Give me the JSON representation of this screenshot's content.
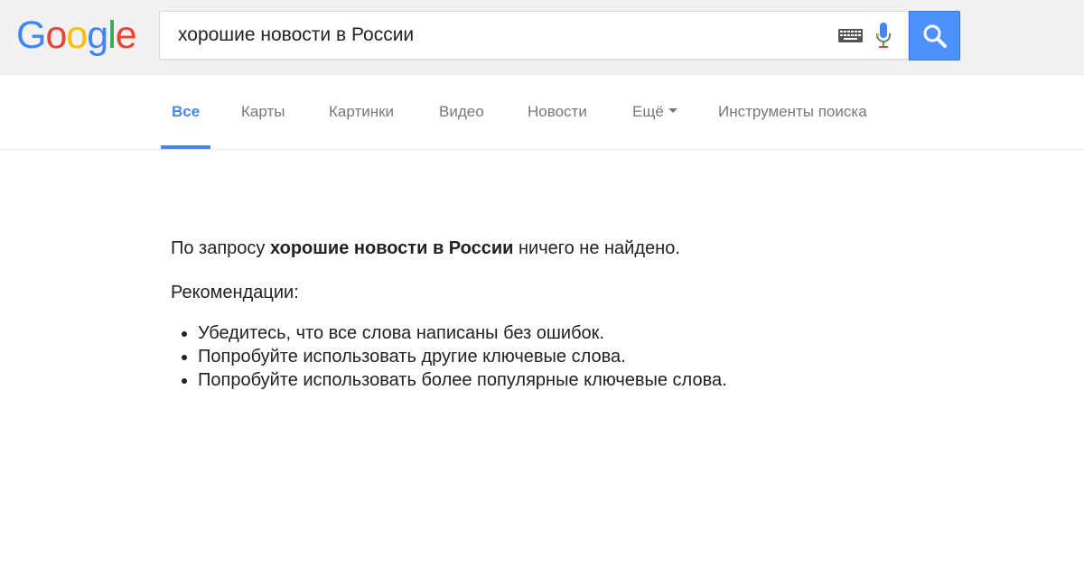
{
  "header": {
    "logo_text": "Google",
    "logo_letters": [
      {
        "ch": "G",
        "color": "#4285f4"
      },
      {
        "ch": "o",
        "color": "#ea4335"
      },
      {
        "ch": "o",
        "color": "#fbbc05"
      },
      {
        "ch": "g",
        "color": "#4285f4"
      },
      {
        "ch": "l",
        "color": "#34a853"
      },
      {
        "ch": "e",
        "color": "#ea4335"
      }
    ],
    "search": {
      "value": "хорошие новости в России",
      "keyboard_icon": "keyboard-icon",
      "mic_icon": "microphone-icon",
      "button_icon": "search-icon"
    },
    "accent_color": "#4d90fe"
  },
  "tabs": [
    {
      "label": "Все",
      "active": true
    },
    {
      "label": "Карты",
      "active": false
    },
    {
      "label": "Картинки",
      "active": false
    },
    {
      "label": "Видео",
      "active": false
    },
    {
      "label": "Новости",
      "active": false
    },
    {
      "label": "Ещё",
      "active": false,
      "has_dropdown": true
    },
    {
      "label": "Инструменты поиска",
      "active": false
    }
  ],
  "results": {
    "no_results_prefix": "По запросу ",
    "no_results_query": "хорошие новости в России",
    "no_results_suffix": " ничего не найдено.",
    "recommendations_title": "Рекомендации:",
    "recommendations": [
      "Убедитесь, что все слова написаны без ошибок.",
      "Попробуйте использовать другие ключевые слова.",
      "Попробуйте использовать более популярные ключевые слова."
    ]
  }
}
